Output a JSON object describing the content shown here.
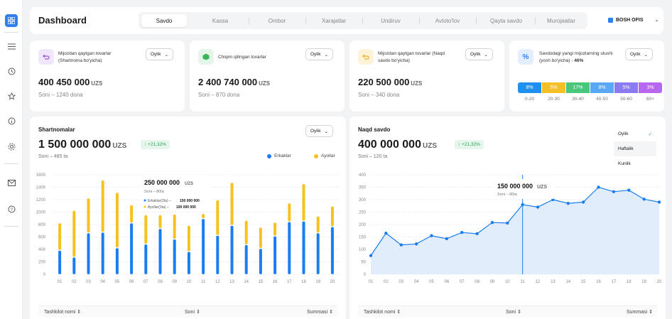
{
  "header": {
    "title": "Dashboard",
    "tabs": [
      "Savdo",
      "Kassa",
      "Ombor",
      "Xarajatlar",
      "Undiruv",
      "Avtoto'lov",
      "Qayta savdo",
      "Murojaatlar"
    ],
    "office": "BOSH OFIS"
  },
  "stats": [
    {
      "title": "Mijozdan qaytgan tovarlar (Shartnoma bo'yicha)",
      "dropdown": "Oylik",
      "value": "400 450 000",
      "unit": "UZS",
      "sub": "Soni – 1240 dona",
      "color": "#f1e6fb",
      "icon_color": "#9b59d0",
      "icon": "return-icon"
    },
    {
      "title": "Chiqim qilingan tovarlar",
      "dropdown": "Oylik",
      "value": "2 400 740 000",
      "unit": "UZS",
      "sub": "Soni – 870 dona",
      "color": "#e3f6e8",
      "icon_color": "#3bb55b",
      "icon": "box-icon"
    },
    {
      "title": "Mijozdan qaytgan tovarlar (Naqd savdo bo'yicha)",
      "dropdown": "Oylik",
      "value": "220 500 000",
      "unit": "UZS",
      "sub": "Soni – 340 dona",
      "color": "#fdf3d8",
      "icon_color": "#e9b21c",
      "icon": "return-icon"
    },
    {
      "title": "Savdodagi yangi mijozlarning ulushi (yosh bo'yicha)",
      "highlight": "46%",
      "dropdown": "Oylik",
      "icon_color": "#2f80ed",
      "color": "#e3efff",
      "icon": "percent-icon"
    }
  ],
  "age": [
    {
      "pct": "8%",
      "label": "0-20",
      "color": "#1f8ff0"
    },
    {
      "pct": "5%",
      "label": "20-30",
      "color": "#f5c027"
    },
    {
      "pct": "17%",
      "label": "30-40",
      "color": "#4ac77a"
    },
    {
      "pct": "8%",
      "label": "40-50",
      "color": "#5aa7f5"
    },
    {
      "pct": "5%",
      "label": "50-60",
      "color": "#8b7bf0"
    },
    {
      "pct": "3%",
      "label": "60+",
      "color": "#b867f0"
    }
  ],
  "contracts": {
    "title": "Shartnomalar",
    "dropdown": "Oylik",
    "value": "1 500 000 000",
    "unit": "UZS",
    "badge": "↑ +21,32%",
    "sub": "Soni – 485 ta",
    "legend": [
      "Erkaklar",
      "Ayollar"
    ],
    "tooltip": {
      "value": "250 000 000",
      "unit": "UZS",
      "sub": "Soni – 80ta",
      "line1": "Erkaklar(2ta) –",
      "line1v": "150 000 000",
      "line2": "Ayollar(2ta) –",
      "line2v": "100 000 000"
    },
    "cols": [
      "Tashkilot nomi ⇕",
      "Soni ⇕",
      "Summasi ⇕"
    ]
  },
  "cash": {
    "title": "Naqd savdo",
    "value": "400 000 000",
    "unit": "UZS",
    "badge": "↑ +21,32%",
    "sub": "Soni – 120 ta",
    "menu": [
      "Oylik",
      "Haftalik",
      "Kunlik"
    ],
    "tooltip": {
      "value": "150 000 000",
      "unit": "UZS",
      "sub": "Soni – 80ta"
    },
    "cols": [
      "Tashkilot nomi ⇕",
      "Soni ⇕",
      "Summasi ⇕"
    ]
  },
  "chart_data": [
    {
      "type": "bar",
      "title": "Shartnomalar",
      "categories": [
        "01",
        "02",
        "03",
        "04",
        "05",
        "06",
        "07",
        "08",
        "09",
        "10",
        "11",
        "12",
        "13",
        "14",
        "15",
        "16",
        "17",
        "18",
        "19",
        "20"
      ],
      "ylim": [
        0,
        1600
      ],
      "yticks": [
        0,
        200,
        400,
        600,
        800,
        1000,
        1200,
        1400,
        1600
      ],
      "series": [
        {
          "name": "Erkaklar",
          "color": "#1a7ef0",
          "values": [
            380,
            270,
            660,
            670,
            420,
            820,
            480,
            730,
            560,
            360,
            890,
            620,
            780,
            470,
            410,
            610,
            840,
            850,
            660,
            760
          ]
        },
        {
          "name": "Ayollar",
          "color": "#f6c21f",
          "values": [
            440,
            750,
            560,
            840,
            890,
            290,
            470,
            220,
            400,
            420,
            80,
            570,
            690,
            390,
            340,
            220,
            300,
            600,
            270,
            330
          ]
        }
      ]
    },
    {
      "type": "area",
      "title": "Naqd savdo",
      "x": [
        "01",
        "02",
        "03",
        "04",
        "05",
        "06",
        "07",
        "08",
        "09",
        "10",
        "11",
        "12",
        "13",
        "14",
        "15",
        "16",
        "17",
        "18",
        "19",
        "20"
      ],
      "ylim": [
        0,
        400
      ],
      "yticks": [
        0,
        50,
        100,
        150,
        200,
        250,
        300,
        350,
        400
      ],
      "values": [
        75,
        165,
        118,
        122,
        155,
        143,
        168,
        163,
        208,
        206,
        280,
        270,
        300,
        285,
        290,
        350,
        332,
        338,
        302,
        290
      ]
    }
  ]
}
